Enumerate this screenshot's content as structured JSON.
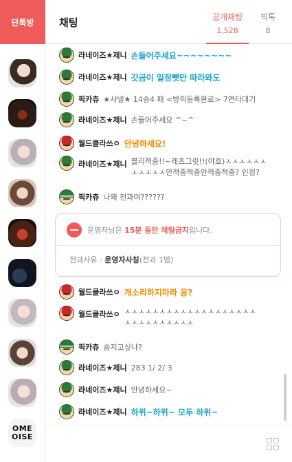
{
  "rail": {
    "button_label": "단톡방",
    "last_avatar_text": [
      "OME",
      "OISE"
    ]
  },
  "header": {
    "title": "채팅",
    "tabs": [
      {
        "label": "공개채팅",
        "count": "1,528"
      },
      {
        "label": "픽톡",
        "count": "8"
      }
    ]
  },
  "messages": [
    {
      "nick": "라네이즈★제니",
      "text": "손들어주세요~~~~~~~~"
    },
    {
      "nick": "라네이즈★제니",
      "text": "갓곰이 일정뺏만 따라와도"
    },
    {
      "nick": "픽카츄",
      "text": "★샤넬★ 14승4 패 <방픽등록완료> 7연타대기"
    },
    {
      "nick": "라네이즈★제니",
      "text": "손들어주세요 ^~^"
    },
    {
      "nick": "월드클라쓰ㅇ",
      "text": "안녕하세요!"
    },
    {
      "nick": "라네이즈★제니",
      "text": "블리젹중!!~레츠그릿!!(야호)ㅅㅅㅅㅅㅅㅅㅅㅅㅅㅅㅅ안젹중젹중안젹중젹중? 인정?"
    },
    {
      "nick": "픽카츄",
      "text": "나왜 전과여??????"
    },
    {
      "nick": "월드클라쓰ㅇ",
      "text": "개소리하지마라 응?"
    },
    {
      "nick": "월드클라쓰ㅇ",
      "text": "ㅅㅅㅅㅅㅅㅅㅅㅅㅅㅅㅅㅅㅅㅅㅅㅅㅅㅅㅅㅅㅅㅅㅅㅅㅅㅅㅅㅅㅅ"
    },
    {
      "nick": "픽카츄",
      "text": "숨지고싶냐?"
    },
    {
      "nick": "라네이즈★제니",
      "text": "283 1/ 2/ 3"
    },
    {
      "nick": "라네이즈★제니",
      "text": "안녕하세요~"
    },
    {
      "nick": "라네이즈★제니",
      "text": "하위~하위~ 모두 하위~"
    }
  ],
  "notice": {
    "prefix": "운영자님은 ",
    "duration": "15분 동안 채팅금지",
    "suffix": "입니다.",
    "reason_label": "전과사유 : ",
    "reason": "운영자사칭",
    "reason_extra": "(전과 1범)"
  },
  "colors": {
    "accent": "#f15a5a",
    "blue_text": "#1aa3c8",
    "orange_text": "#f08a00"
  }
}
